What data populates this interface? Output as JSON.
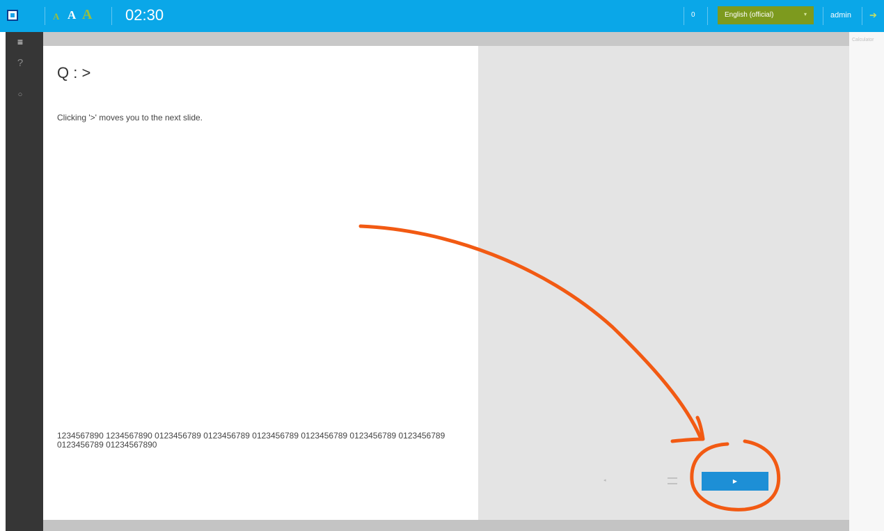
{
  "topbar": {
    "font_small": "A",
    "font_medium": "A",
    "font_large": "A",
    "timer": "02:30",
    "count": "0",
    "language": "English (official)",
    "language_caret": "▾",
    "user": "admin",
    "logout_icon": "exit-icon"
  },
  "sidebar": {
    "menu_icon": "≡",
    "help_icon": "?",
    "ring_icon": "○"
  },
  "right_panel": {
    "label": "Calculator"
  },
  "question": {
    "title": "Q : >",
    "text": "Clicking '>' moves you to the next slide.",
    "digits": "1234567890 1234567890 0123456789 0123456789 0123456789 0123456789 0123456789 0123456789 0123456789 01234567890"
  },
  "controls": {
    "flag_icon": "◂",
    "next_label": "▶"
  },
  "annotation": {
    "color": "#f25a13"
  }
}
